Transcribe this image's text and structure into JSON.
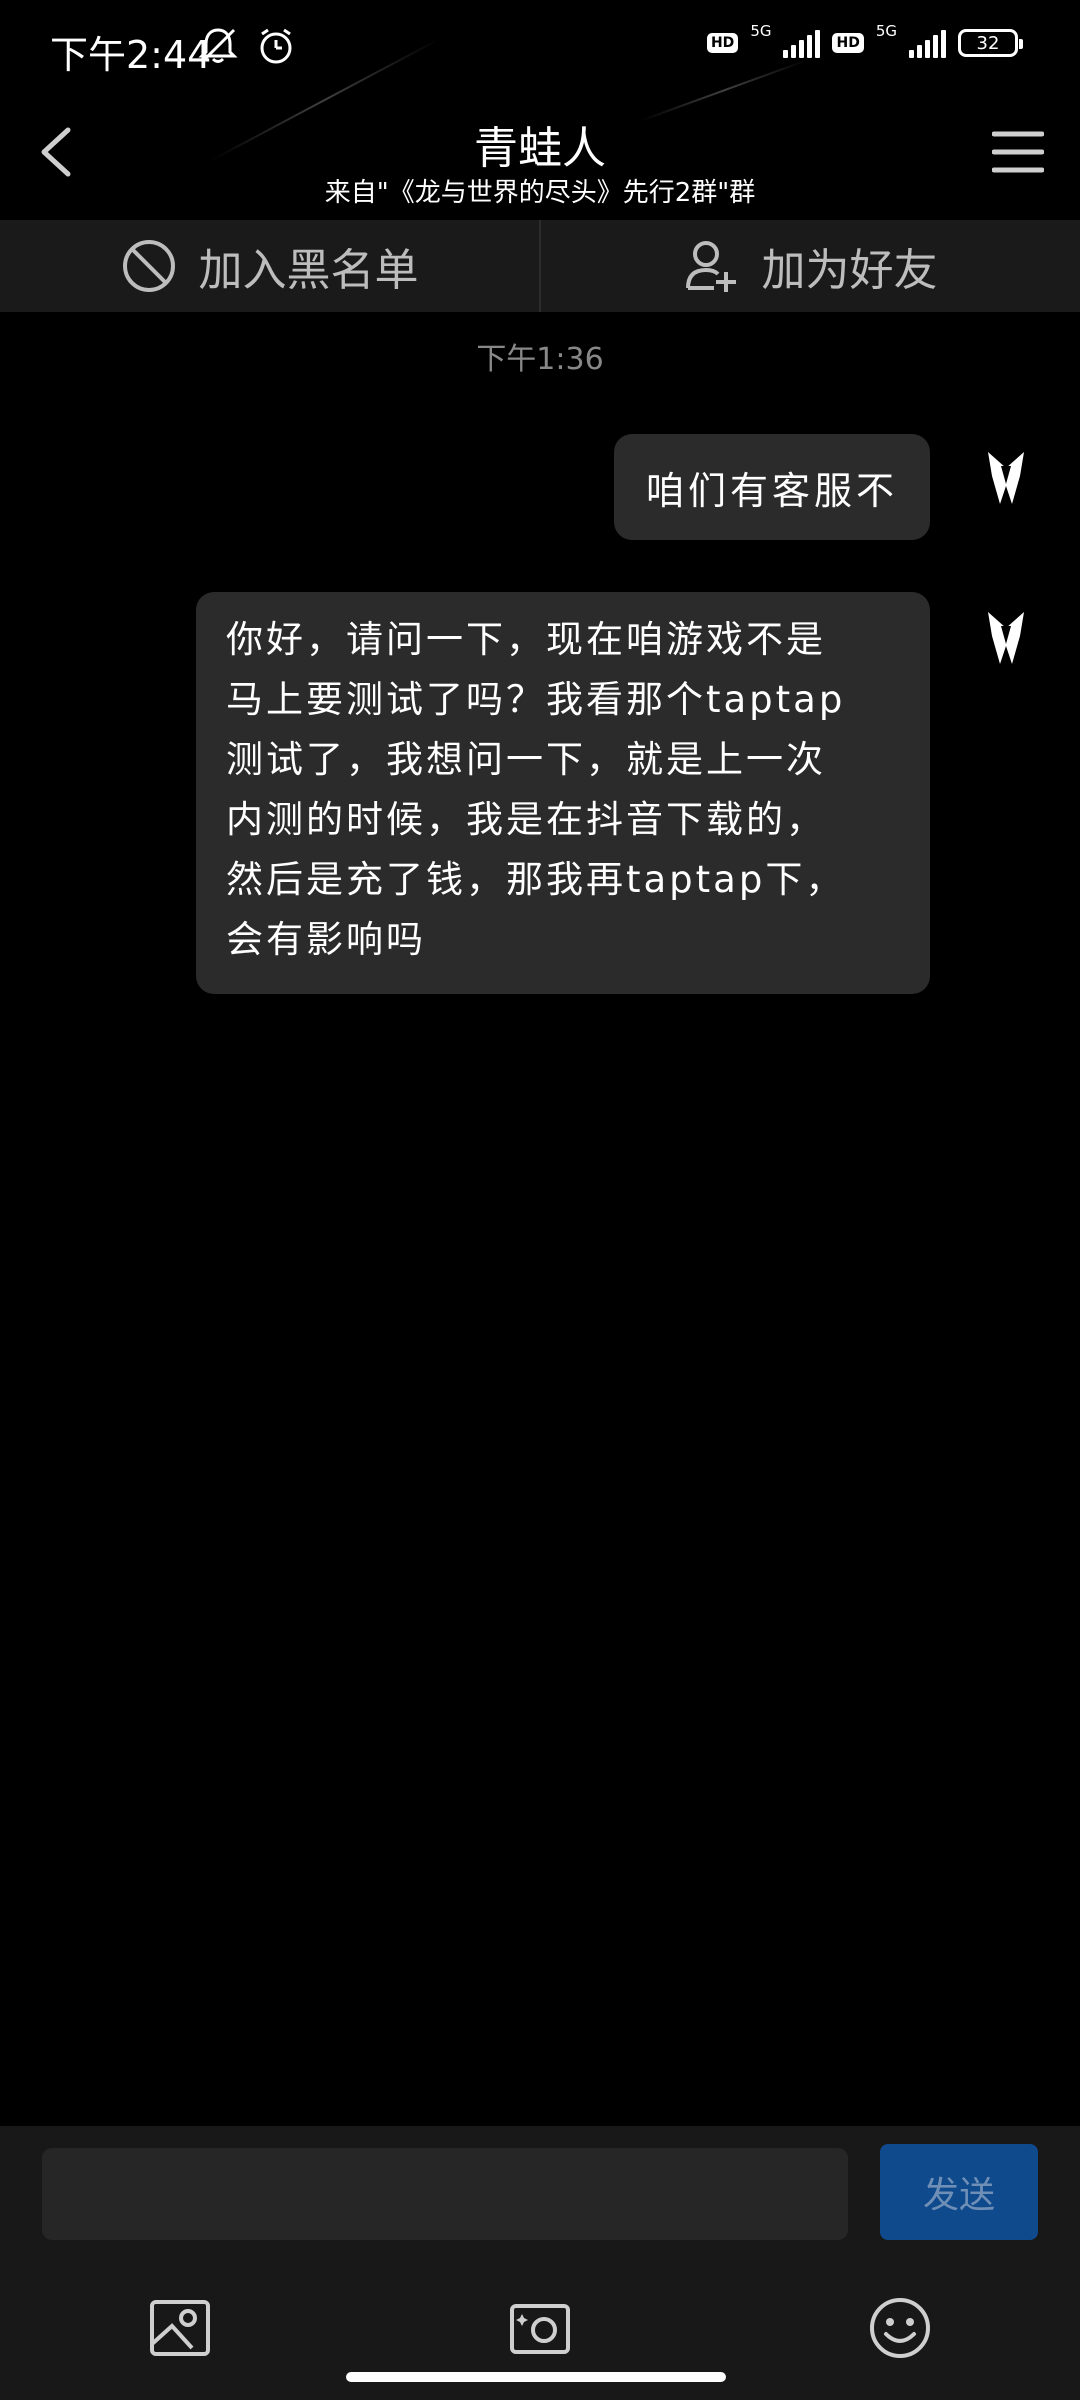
{
  "status_bar": {
    "time": "下午2:44",
    "network_1": "5G",
    "network_2": "5G",
    "hd_1": "HD",
    "hd_2": "HD",
    "battery": "32"
  },
  "header": {
    "title": "青蛙人",
    "subtitle": "来自\"《龙与世界的尽头》先行2群\"群"
  },
  "actions": {
    "block_label": "加入黑名单",
    "add_friend_label": "加为好友"
  },
  "chat": {
    "timestamp": "下午1:36",
    "messages": [
      {
        "lines": [
          "咱们有客服不"
        ]
      },
      {
        "lines": [
          "你好，请问一下，现在咱游戏不是",
          "马上要测试了吗？我看那个taptap",
          "测试了，我想问一下，就是上一次",
          "内测的时候，我是在抖音下载的，",
          "然后是充了钱，那我再taptap下，",
          "会有影响吗"
        ]
      }
    ]
  },
  "composer": {
    "input_value": "",
    "send_label": "发送"
  },
  "colors": {
    "background": "#000000",
    "bubble": "#2b2b2b",
    "action_bar": "#1a1a1a",
    "send_button": "#0e4a8c"
  }
}
